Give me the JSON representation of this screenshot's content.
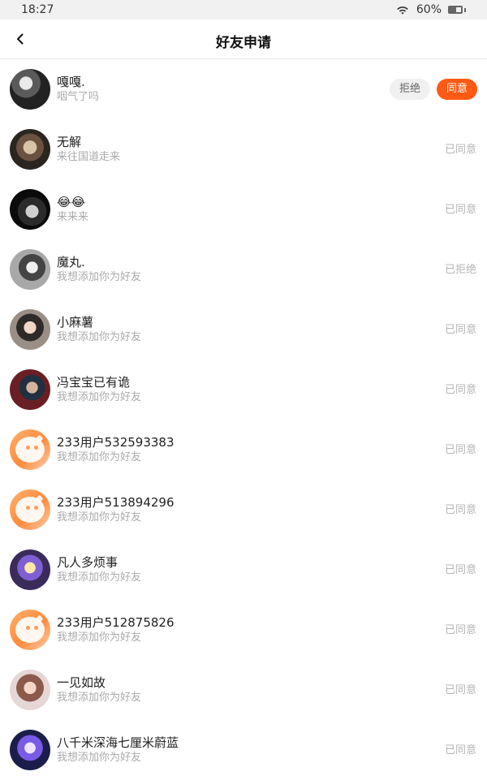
{
  "status_bar": {
    "time": "18:27",
    "battery": "60%"
  },
  "header": {
    "title": "好友申请"
  },
  "actions": {
    "reject_label": "拒绝",
    "accept_label": "同意"
  },
  "items": [
    {
      "name": "嘎嘎.",
      "message": "咽气了吗",
      "avatar": "photo-1"
    },
    {
      "name": "无解",
      "message": "来往国道走来",
      "status": "已同意",
      "avatar": "photo-2"
    },
    {
      "name": "😂😂",
      "message": "来来来",
      "status": "已同意",
      "avatar": "photo-3"
    },
    {
      "name": "魔丸.",
      "message": "我想添加你为好友",
      "status": "已拒绝",
      "avatar": "photo-4"
    },
    {
      "name": "小麻薯",
      "message": "我想添加你为好友",
      "status": "已同意",
      "avatar": "photo-5"
    },
    {
      "name": "冯宝宝已有诡",
      "message": "我想添加你为好友",
      "status": "已同意",
      "avatar": "photo-6"
    },
    {
      "name": "233用户532593383",
      "message": "我想添加你为好友",
      "status": "已同意",
      "avatar": "default"
    },
    {
      "name": "233用户513894296",
      "message": "我想添加你为好友",
      "status": "已同意",
      "avatar": "default"
    },
    {
      "name": "凡人多烦事",
      "message": "我想添加你为好友",
      "status": "已同意",
      "avatar": "photo-7"
    },
    {
      "name": "233用户512875826",
      "message": "我想添加你为好友",
      "status": "已同意",
      "avatar": "default"
    },
    {
      "name": "一见如故",
      "message": "我想添加你为好友",
      "status": "已同意",
      "avatar": "photo-8"
    },
    {
      "name": "八千米深海七厘米蔚蓝",
      "message": "我想添加你为好友",
      "status": "已同意",
      "avatar": "photo-9"
    }
  ]
}
